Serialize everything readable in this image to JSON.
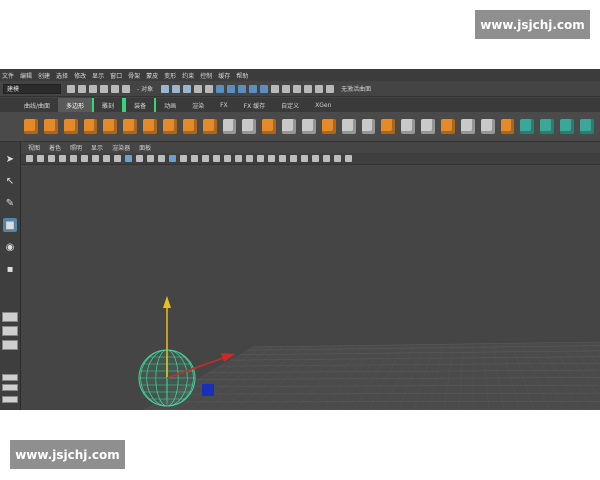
{
  "watermark": {
    "text": "www.jsjchj.com"
  },
  "menubar": {
    "items": [
      "文件",
      "编辑",
      "创建",
      "选择",
      "修改",
      "显示",
      "窗口",
      "骨架",
      "蒙皮",
      "变形",
      "约束",
      "控制",
      "缓存",
      "帮助"
    ]
  },
  "statusline": {
    "mode": "建模",
    "object_label": "- 对象",
    "no_live_surface": "无激活曲面"
  },
  "shelf_tabs": [
    {
      "label": "曲线/曲面",
      "active": false,
      "marked": false
    },
    {
      "label": "多边形",
      "active": true,
      "marked": false
    },
    {
      "label": "雕刻",
      "active": false,
      "marked": true
    },
    {
      "label": "装备",
      "active": false,
      "marked": true
    },
    {
      "label": "动画",
      "active": false,
      "marked": false
    },
    {
      "label": "渲染",
      "active": false,
      "marked": false
    },
    {
      "label": "FX",
      "active": false,
      "marked": false
    },
    {
      "label": "FX 缓存",
      "active": false,
      "marked": false
    },
    {
      "label": "自定义",
      "active": false,
      "marked": false
    },
    {
      "label": "XGen",
      "active": false,
      "marked": false
    }
  ],
  "shelf_icons": [
    "poly-sphere-icon",
    "poly-cube-icon",
    "poly-cylinder-icon",
    "poly-cone-icon",
    "poly-torus-icon",
    "poly-plane-icon",
    "poly-disk-icon",
    "poly-pyramid-icon",
    "poly-pipe-icon",
    "combine-icon",
    "separate-icon",
    "smooth-icon",
    "extract-icon",
    "bevel-icon",
    "bridge-icon",
    "extrude-icon",
    "bool-icon",
    "mirror-icon",
    "uv-icon",
    "multicut-icon",
    "target-weld-icon",
    "connect-icon",
    "insert-loop-icon",
    "offset-loop-icon",
    "fill-hole-icon",
    "planar-map-icon",
    "auto-map-icon",
    "cylindrical-map-icon",
    "spherical-map-icon"
  ],
  "panel_menu": {
    "items": [
      "视图",
      "着色",
      "照明",
      "显示",
      "渲染器",
      "面板"
    ]
  },
  "tools": [
    "select-tool-icon",
    "lasso-tool-icon",
    "paint-select-tool-icon",
    "move-tool-icon",
    "rotate-tool-icon",
    "scale-tool-icon"
  ],
  "colors": {
    "accent": "#5285a6",
    "shelf_icon": "#e48a28",
    "sphere_wire": "#46d19a",
    "axis_y": "#e8c21a",
    "axis_x": "#cc2a2a",
    "axis_z": "#1a2fb8",
    "marker": "#33d67a"
  }
}
